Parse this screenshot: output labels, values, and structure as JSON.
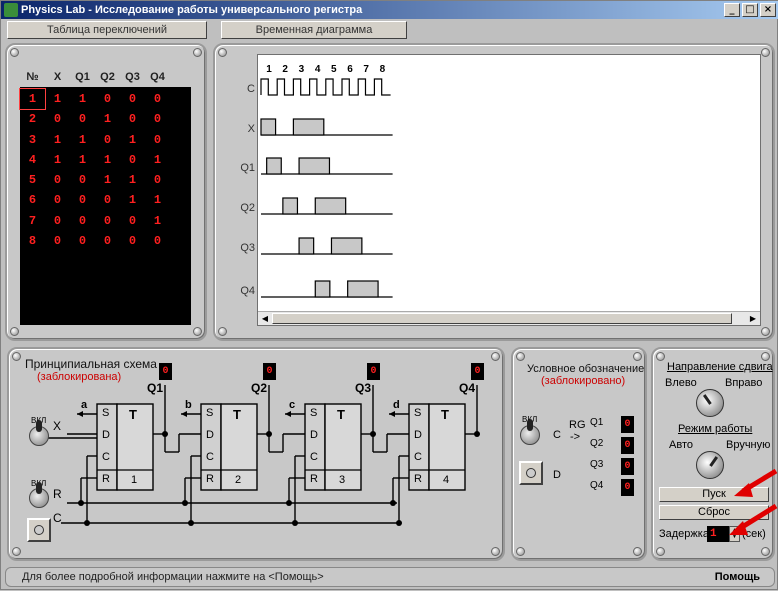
{
  "window": {
    "title": "Physics Lab - Исследование работы универсального регистра",
    "min_glyph": "_",
    "max_glyph": "□",
    "close_glyph": "×"
  },
  "tabs": {
    "switch_table": "Таблица переключений",
    "timing_diagram": "Временная диаграмма"
  },
  "switch_table": {
    "headers": [
      "№",
      "X",
      "Q1",
      "Q2",
      "Q3",
      "Q4"
    ],
    "rows": [
      [
        "1",
        "1",
        "1",
        "0",
        "0",
        "0"
      ],
      [
        "2",
        "0",
        "0",
        "1",
        "0",
        "0"
      ],
      [
        "3",
        "1",
        "1",
        "0",
        "1",
        "0"
      ],
      [
        "4",
        "1",
        "1",
        "1",
        "0",
        "1"
      ],
      [
        "5",
        "0",
        "0",
        "1",
        "1",
        "0"
      ],
      [
        "6",
        "0",
        "0",
        "0",
        "1",
        "1"
      ],
      [
        "7",
        "0",
        "0",
        "0",
        "0",
        "1"
      ],
      [
        "8",
        "0",
        "0",
        "0",
        "0",
        "0"
      ]
    ]
  },
  "timing": {
    "clock_numbers": [
      "1",
      "2",
      "3",
      "4",
      "5",
      "6",
      "7",
      "8"
    ],
    "signals": [
      "C",
      "X",
      "Q1",
      "Q2",
      "Q3",
      "Q4"
    ],
    "waveforms": {
      "X": [
        1,
        0,
        1,
        1,
        0,
        0,
        0,
        0
      ],
      "Q1": [
        1,
        0,
        1,
        1,
        0,
        0,
        0,
        0
      ],
      "Q2": [
        0,
        1,
        0,
        1,
        1,
        0,
        0,
        0
      ],
      "Q3": [
        0,
        0,
        1,
        0,
        1,
        1,
        0,
        0
      ],
      "Q4": [
        0,
        0,
        0,
        1,
        0,
        1,
        1,
        0
      ]
    }
  },
  "schematic": {
    "title": "Принципиальная схема",
    "locked": "(заблокирована)",
    "outputs": [
      "Q1",
      "Q2",
      "Q3",
      "Q4"
    ],
    "output_values": [
      "0",
      "0",
      "0",
      "0"
    ],
    "out_letters": [
      "a",
      "b",
      "c",
      "d"
    ],
    "trigger_label": "T",
    "pins": [
      "S",
      "D",
      "C",
      "R"
    ],
    "trigger_numbers": [
      "1",
      "2",
      "3",
      "4"
    ],
    "input_x": "X",
    "input_r": "R",
    "input_c": "C",
    "toggle_on": "ВКЛ"
  },
  "symbol": {
    "title": "Условное обозначение",
    "locked": "(заблокировано)",
    "rg_label": "RG",
    "arrow": "->",
    "pin_c": "C",
    "pin_d": "D",
    "outputs": [
      "Q1",
      "Q2",
      "Q3",
      "Q4"
    ],
    "output_values": [
      "0",
      "0",
      "0",
      "0"
    ],
    "toggle_on": "ВКЛ"
  },
  "controls": {
    "shift_dir_label": "Направление сдвига",
    "left": "Влево",
    "right": "Вправо",
    "mode_label": "Режим работы",
    "auto": "Авто",
    "manual": "Вручную",
    "start_button": "Пуск",
    "reset_button": "Сброс",
    "delay_label": "Задержка",
    "delay_value": "1",
    "delay_unit": "(сек)",
    "spin_up": "▲",
    "spin_down": "▼"
  },
  "status": {
    "message": "Для более подробной информации нажмите на <Помощь>",
    "help": "Помощь"
  },
  "colors": {
    "display_red": "#ff2020",
    "pulse_fill": "#c8c8c8",
    "arrow_red": "#e00000"
  }
}
